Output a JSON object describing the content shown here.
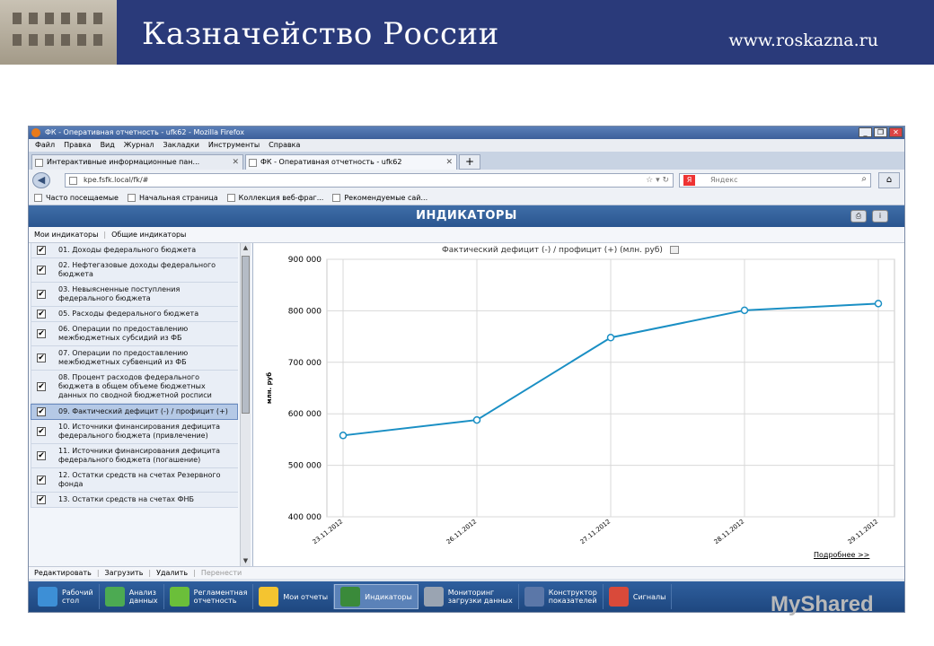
{
  "slide": {
    "title": "Казначейство России",
    "url": "www.roskazna.ru"
  },
  "browser": {
    "window_title": "ФК - Оперативная отчетность - ufk62 - Mozilla Firefox",
    "menu": [
      "Файл",
      "Правка",
      "Вид",
      "Журнал",
      "Закладки",
      "Инструменты",
      "Справка"
    ],
    "tabs": [
      {
        "label": "Интерактивные информационные пан..."
      },
      {
        "label": "ФК - Оперативная отчетность - ufk62"
      }
    ],
    "address": "kpe.fsfk.local/fk/#",
    "search_placeholder": "Яндекс",
    "bookmarks": [
      "Часто посещаемые",
      "Начальная страница",
      "Коллекция веб-фраг...",
      "Рекомендуемые сай..."
    ]
  },
  "app": {
    "title": "ИНДИКАТОРЫ",
    "subtabs": [
      "Мои индикаторы",
      "Общие индикаторы"
    ],
    "indicators": [
      {
        "label": "01. Доходы федерального бюджета",
        "selected": false
      },
      {
        "label": "02. Нефтегазовые доходы федерального бюджета",
        "selected": false
      },
      {
        "label": "03. Невыясненные поступления федерального бюджета",
        "selected": false
      },
      {
        "label": "05. Расходы федерального бюджета",
        "selected": false
      },
      {
        "label": "06. Операции по предоставлению межбюджетных субсидий из ФБ",
        "selected": false
      },
      {
        "label": "07. Операции по предоставлению межбюджетных субвенций из ФБ",
        "selected": false
      },
      {
        "label": "08. Процент расходов федерального бюджета в общем объеме бюджетных данных по сводной бюджетной росписи",
        "selected": false
      },
      {
        "label": "09. Фактический дефицит (-) / профицит (+)",
        "selected": true
      },
      {
        "label": "10. Источники финансирования дефицита федерального бюджета (привлечение)",
        "selected": false
      },
      {
        "label": "11. Источники финансирования дефицита федерального бюджета (погашение)",
        "selected": false
      },
      {
        "label": "12. Остатки средств на счетах Резервного фонда",
        "selected": false
      },
      {
        "label": "13. Остатки средств на счетах ФНБ",
        "selected": false
      }
    ],
    "actions": [
      "Редактировать",
      "Загрузить",
      "Удалить",
      "Перенести"
    ],
    "more_link": "Подробнее >>",
    "bottom_nav": [
      {
        "line1": "Рабочий",
        "line2": "стол",
        "color": "#3d8fd6",
        "icon": "desktop-icon"
      },
      {
        "line1": "Анализ",
        "line2": "данных",
        "color": "#4caa52",
        "icon": "analysis-icon"
      },
      {
        "line1": "Регламентная",
        "line2": "отчетность",
        "color": "#6bbf3a",
        "icon": "report-icon"
      },
      {
        "line1": "Мои отчеты",
        "line2": "",
        "color": "#f4c430",
        "icon": "star-icon"
      },
      {
        "line1": "Индикаторы",
        "line2": "",
        "color": "#3a8a3a",
        "icon": "indicators-icon"
      },
      {
        "line1": "Мониторинг",
        "line2": "загрузки данных",
        "color": "#9aa4b2",
        "icon": "monitor-icon"
      },
      {
        "line1": "Конструктор",
        "line2": "показателей",
        "color": "#5b77a8",
        "icon": "function-icon"
      },
      {
        "line1": "Сигналы",
        "line2": "",
        "color": "#d94a3a",
        "icon": "signals-icon"
      }
    ]
  },
  "chart_data": {
    "type": "line",
    "title": "Фактический дефицит (-) / профицит (+) (млн. руб)",
    "ylabel": "млн. руб",
    "xlabel": "",
    "categories": [
      "23.11.2012",
      "26.11.2012",
      "27.11.2012",
      "28.11.2012",
      "29.11.2012"
    ],
    "series": [
      {
        "values": [
          558000,
          588000,
          748000,
          801000,
          814000
        ],
        "color": "#1a8fc4"
      }
    ],
    "ylim": [
      400000,
      900000
    ],
    "yticks": [
      "400 000",
      "500 000",
      "600 000",
      "700 000",
      "800 000",
      "900 000"
    ],
    "grid": true
  },
  "watermark": "MyShared"
}
